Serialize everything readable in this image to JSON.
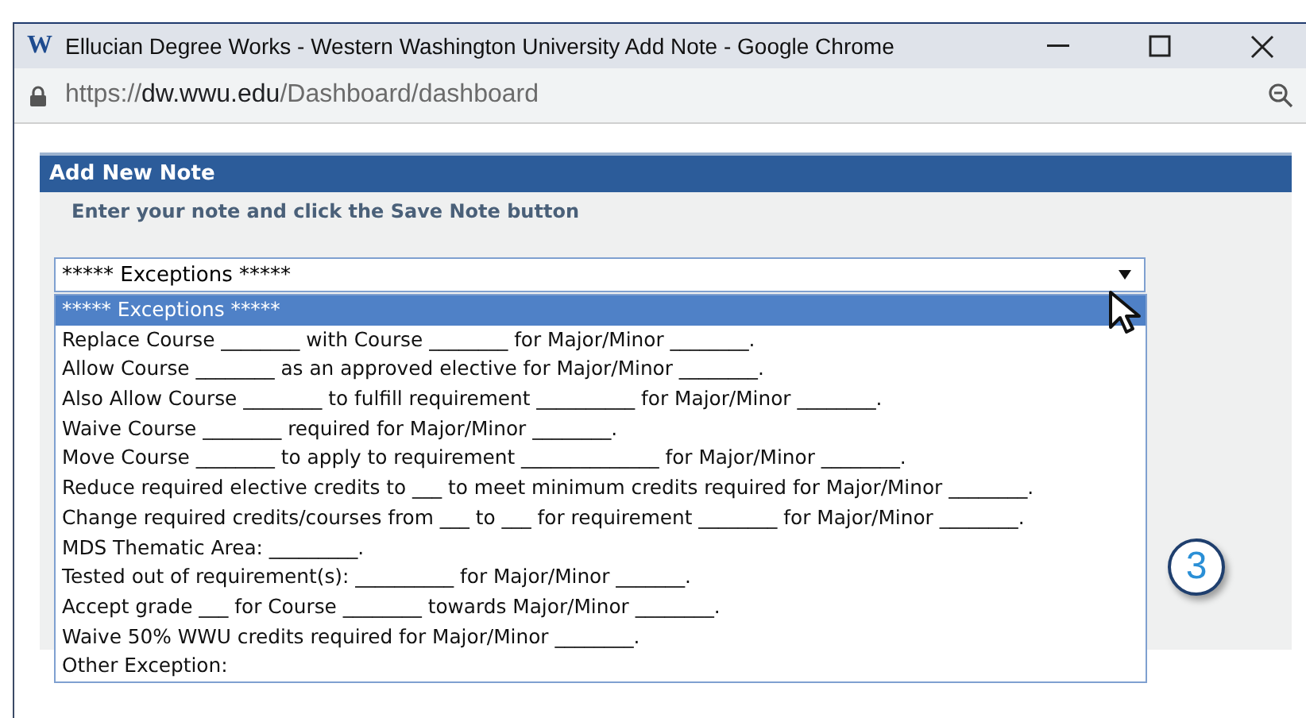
{
  "window": {
    "logo": "W",
    "title": "Ellucian Degree Works - Western Washington University Add Note - Google Chrome",
    "url_scheme": "https://",
    "url_host": "dw.wwu.edu",
    "url_path": "/Dashboard/dashboard"
  },
  "panel": {
    "heading": "Add New Note",
    "instruction": "Enter your note and click the Save Note button"
  },
  "note_select": {
    "value": "***** Exceptions *****",
    "expanded": true,
    "options": [
      {
        "label": "***** Exceptions *****",
        "selected": true
      },
      {
        "label": "Replace Course ________ with Course ________ for Major/Minor ________.",
        "selected": false
      },
      {
        "label": "Allow Course ________ as an approved elective for Major/Minor ________.",
        "selected": false
      },
      {
        "label": "Also Allow Course ________ to fulfill requirement __________ for Major/Minor ________.",
        "selected": false
      },
      {
        "label": "Waive Course ________ required for Major/Minor ________.",
        "selected": false
      },
      {
        "label": "Move Course ________ to apply to requirement ______________ for Major/Minor ________.",
        "selected": false
      },
      {
        "label": "Reduce required elective credits to ___ to meet minimum credits required for Major/Minor ________.",
        "selected": false
      },
      {
        "label": "Change required credits/courses from ___ to ___ for requirement ________ for Major/Minor ________.",
        "selected": false
      },
      {
        "label": "MDS Thematic Area: _________.",
        "selected": false
      },
      {
        "label": "Tested out of requirement(s): __________ for Major/Minor _______.",
        "selected": false
      },
      {
        "label": "Accept grade ___ for Course ________ towards Major/Minor ________.",
        "selected": false
      },
      {
        "label": "Waive 50% WWU credits required for Major/Minor ________.",
        "selected": false
      },
      {
        "label": "Other Exception:",
        "selected": false
      }
    ]
  },
  "callout": "3"
}
